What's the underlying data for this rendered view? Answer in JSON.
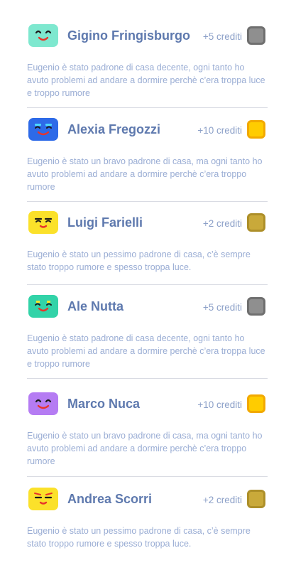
{
  "reviews": [
    {
      "name": "Gigino Fringisburgo",
      "credits": "+5 crediti",
      "text": "Eugenio è stato padrone di casa decente, ogni tanto ho avuto problemi ad andare a dormire perchè c’era troppa luce e troppo rumore",
      "avatar_color": "#7ee8cf",
      "coin": "gray-coin-icon"
    },
    {
      "name": "Alexia Fregozzi",
      "credits": "+10 crediti",
      "text": "Eugenio è stato un bravo padrone di casa, ma ogni tanto ho avuto problemi ad andare a dormire perchè c’era troppo rumore",
      "avatar_color": "#2d6ae8",
      "coin": "gold-coin-icon"
    },
    {
      "name": "Luigi Farielli",
      "credits": "+2 crediti",
      "text": "Eugenio è stato un pessimo padrone di casa, c’è sempre stato troppo rumore e spesso troppa luce.",
      "avatar_color": "#fbe12a",
      "coin": "olive-coin-icon"
    },
    {
      "name": "Ale Nutta",
      "credits": "+5 crediti",
      "text": "Eugenio è stato padrone di casa decente, ogni tanto ho avuto problemi ad andare a dormire perchè c’era troppa luce e troppo rumore",
      "avatar_color": "#32d3a8",
      "coin": "gray-coin-icon"
    },
    {
      "name": "Marco Nuca",
      "credits": "+10 crediti",
      "text": "Eugenio è stato un bravo padrone di casa, ma ogni tanto ho avuto problemi ad andare a dormire perchè c’era troppo rumore",
      "avatar_color": "#b57cf3",
      "coin": "gold-coin-icon"
    },
    {
      "name": "Andrea Scorri",
      "credits": "+2 crediti",
      "text": "Eugenio è stato un pessimo padrone di casa, c’è sempre stato troppo rumore e spesso troppa luce.",
      "avatar_color": "#fbe12a",
      "coin": "olive-coin-icon"
    }
  ]
}
